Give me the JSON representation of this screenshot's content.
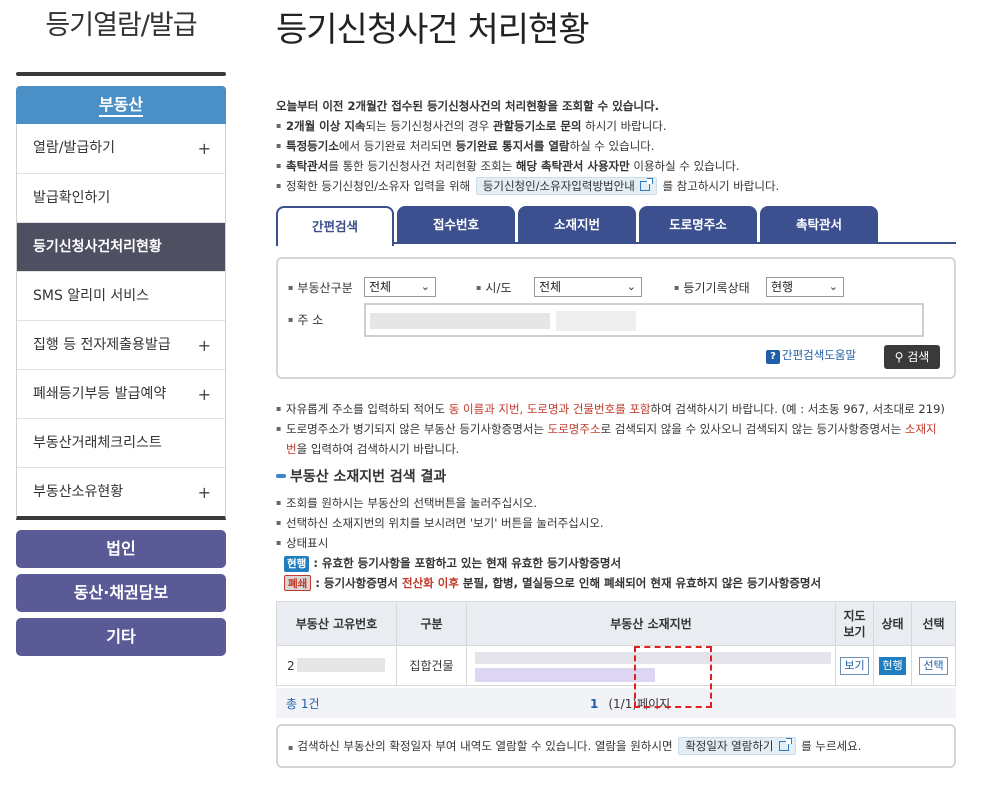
{
  "sidebar": {
    "title": "등기열람/발급",
    "header": "부동산",
    "items": [
      {
        "label": "열람/발급하기",
        "plus": "+"
      },
      {
        "label": "발급확인하기",
        "plus": ""
      },
      {
        "label": "등기신청사건처리현황",
        "plus": ""
      },
      {
        "label": "SMS 알리미 서비스",
        "plus": ""
      },
      {
        "label": "집행 등 전자제출용발급",
        "plus": "+"
      },
      {
        "label": "폐쇄등기부등 발급예약",
        "plus": "+"
      },
      {
        "label": "부동산거래체크리스트",
        "plus": ""
      },
      {
        "label": "부동산소유현황",
        "plus": "+"
      }
    ],
    "buttons": [
      "법인",
      "동산·채권담보",
      "기타"
    ]
  },
  "main": {
    "title": "등기신청사건 처리현황",
    "intro_lead": "오늘부터 이전 2개월간 접수된 등기신청사건의 처리현황을 조회할 수 있습니다.",
    "intro": {
      "l1a": "2개월 이상 지속",
      "l1b": "되는 등기신청사건의 경우 ",
      "l1c": "관할등기소로 문의",
      "l1d": " 하시기 바랍니다.",
      "l2a": "특정등기소",
      "l2b": "에서 등기완료 처리되면 ",
      "l2c": "등기완료 통지서를 열람",
      "l2d": "하실 수 있습니다.",
      "l3a": "촉탁관서",
      "l3b": "를 통한 등기신청사건 처리현황 조회는 ",
      "l3c": "해당 촉탁관서 사용자만",
      "l3d": " 이용하실 수 있습니다.",
      "l4a": "정확한 등기신청인/소유자 입력을 위해",
      "l4btn": "등기신청인/소유자입력방법안내",
      "l4b": "를 참고하시기 바랍니다."
    },
    "tabs": [
      "간편검색",
      "접수번호",
      "소재지번",
      "도로명주소",
      "촉탁관서"
    ],
    "search": {
      "type_label": "부동산구분",
      "type_value": "전체",
      "region_label": "시/도",
      "region_value": "전체",
      "status_label": "등기기록상태",
      "status_value": "현행",
      "addr_label": "주 소",
      "help": "간편검색도움말",
      "button": "검색"
    },
    "notes": {
      "n1a": "자유롭게 주소를 입력하되 적어도 ",
      "n1b": "동 이름과 지번, 도로명과 건물번호를 포함",
      "n1c": "하여 검색하시기 바랍니다. (예 : 서초동 967, 서초대로 219)",
      "n2a": "도로명주소가 병기되지 않은 부동산 등기사항증명서는 ",
      "n2b": "도로명주소",
      "n2c": "로 검색되지 않을 수 있사오니 검색되지 않는 등기사항증명서는 ",
      "n2d": "소재지",
      "n2e": "번",
      "n2f": "을 입력하여 검색하시기 바랍니다."
    },
    "result_title": "부동산 소재지번 검색 결과",
    "result_notes": {
      "r1": "조회를 원하시는 부동산의 선택버튼을 눌러주십시오.",
      "r2": "선택하신 소재지번의 위치를 보시려면 '보기' 버튼을 눌러주십시오.",
      "r3": "상태표시",
      "badge_cur": "현행",
      "desc_cur": " : 유효한 등기사항을 포함하고 있는 현재 유효한 등기사항증명서",
      "badge_closed": "폐쇄",
      "desc_closed_a": " : 등기사항증명서 ",
      "desc_closed_b": "전산화 이후",
      "desc_closed_c": " 분필, 합병, 멸실등으로 인해 폐쇄되어 현재 유효하지 않은 등기사항증명서"
    },
    "table": {
      "headers": [
        "부동산 고유번호",
        "구분",
        "부동산 소재지번",
        "지도\n보기",
        "상태",
        "선택"
      ],
      "header_map_1": "지도",
      "header_map_2": "보기",
      "row": {
        "id_prefix": "2",
        "type": "집합건물",
        "view": "보기",
        "status": "현행",
        "select": "선택"
      }
    },
    "pager": {
      "total": "총 1건",
      "page_num": "1",
      "page_info": "(1/1)페이지"
    },
    "bottom": {
      "a": "검색하신 부동산의 확정일자 부여 내역도 열람할 수 있습니다. 열람을 원하시면",
      "btn": "확정일자 열람하기",
      "b": "를 누르세요."
    }
  }
}
